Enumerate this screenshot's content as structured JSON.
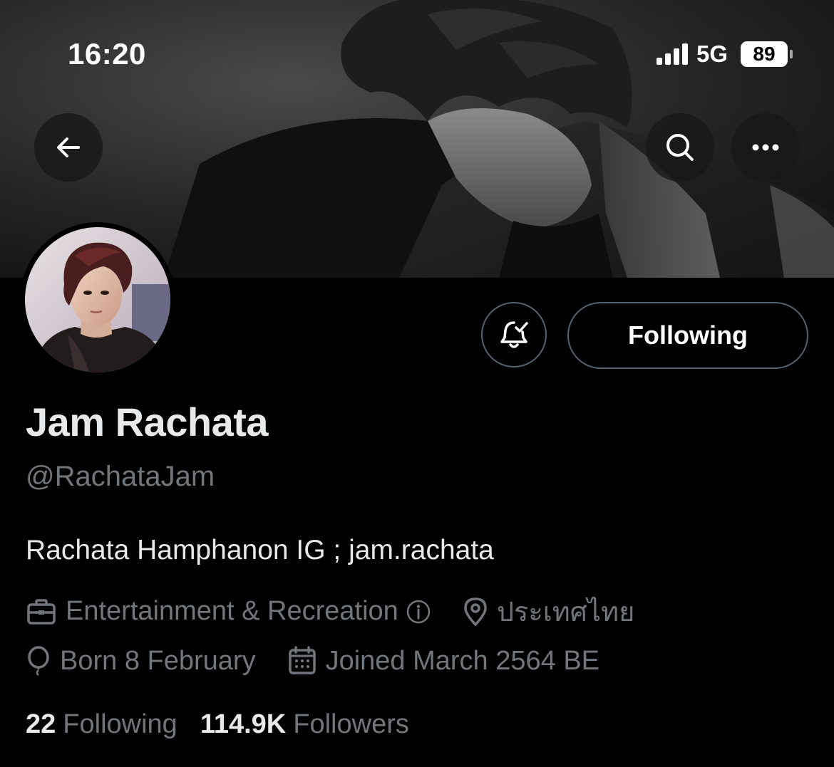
{
  "status_bar": {
    "time": "16:20",
    "network": "5G",
    "battery": "89"
  },
  "profile": {
    "display_name": "Jam Rachata",
    "handle": "@RachataJam",
    "bio": "Rachata Hamphanon IG ; jam.rachata",
    "category": "Entertainment & Recreation",
    "location": "ประเทศไทย",
    "born": "Born 8 February",
    "joined": "Joined March 2564 BE"
  },
  "actions": {
    "following_label": "Following"
  },
  "stats": {
    "following_count": "22",
    "following_label": "Following",
    "followers_count": "114.9K",
    "followers_label": "Followers"
  },
  "icons": {
    "back": "arrow-left-icon",
    "search": "search-icon",
    "more": "more-horizontal-icon",
    "notifications": "bell-check-icon",
    "category": "briefcase-icon",
    "location": "location-pin-icon",
    "birthday": "balloon-icon",
    "joined": "calendar-icon",
    "info": "info-icon"
  },
  "colors": {
    "background": "#000000",
    "primary_text": "#e7e9ea",
    "secondary_text": "#71767b",
    "border": "#536471"
  }
}
